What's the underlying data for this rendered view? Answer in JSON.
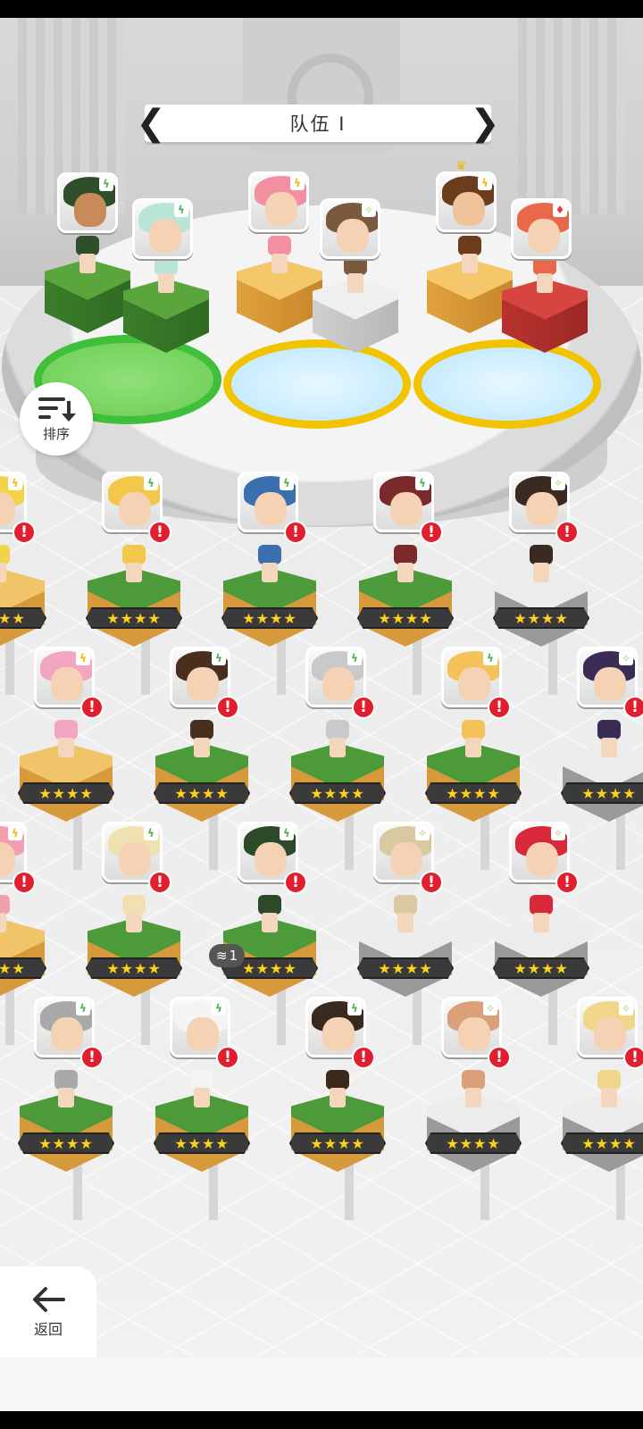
{
  "team": {
    "title": "队伍 I",
    "prev": "❮",
    "next": "❯"
  },
  "sort": {
    "label": "排序"
  },
  "back": {
    "label": "返回"
  },
  "copy_badge": {
    "count": "1"
  },
  "colors": {
    "alert": "#e0202f",
    "star": "#ffd21a",
    "green_pad": "#3fbf3a",
    "yellow_pad": "#f2c400"
  },
  "team_members": [
    {
      "element": "ϟ",
      "element_color": "#4caf50",
      "hair": "#2f4f2a",
      "skin": "#c98a5a",
      "block": "green"
    },
    {
      "element": "ϟ",
      "element_color": "#4caf50",
      "hair": "#b9e4d8",
      "skin": "#f6d2b5",
      "block": "green"
    },
    {
      "element": "ϟ",
      "element_color": "#f2b700",
      "hair": "#f28fa0",
      "skin": "#f6d2b5",
      "block": "gold"
    },
    {
      "element": "✧",
      "element_color": "#9ccc65",
      "hair": "#7a5a3c",
      "skin": "#f6d2b5",
      "block": "white"
    },
    {
      "element": "ϟ",
      "element_color": "#f2b700",
      "hair": "#6b3d1c",
      "skin": "#f0c39a",
      "block": "gold",
      "leader": true
    },
    {
      "element": "♦",
      "element_color": "#e53935",
      "hair": "#e8694a",
      "skin": "#f6d2b5",
      "block": "red"
    }
  ],
  "rows": [
    [
      {
        "element": "ϟ",
        "element_color": "#f2b700",
        "hair": "#f3d34a",
        "ped": "gold",
        "stars": "★★★★"
      },
      {
        "element": "ϟ",
        "element_color": "#4caf50",
        "hair": "#f2c84a",
        "ped": "green",
        "stars": "★★★★"
      },
      {
        "element": "ϟ",
        "element_color": "#4caf50",
        "hair": "#3a6fb0",
        "ped": "green",
        "stars": "★★★★"
      },
      {
        "element": "ϟ",
        "element_color": "#4caf50",
        "hair": "#7a2a2a",
        "ped": "green",
        "stars": "★★★★"
      },
      {
        "element": "✧",
        "element_color": "#9ccc65",
        "hair": "#3a2a22",
        "ped": "white",
        "stars": "★★★★"
      }
    ],
    [
      {
        "element": "ϟ",
        "element_color": "#f2b700",
        "hair": "#f2a6c0",
        "ped": "gold",
        "stars": "★★★★"
      },
      {
        "element": "ϟ",
        "element_color": "#4caf50",
        "hair": "#4a2e1e",
        "ped": "green",
        "stars": "★★★★"
      },
      {
        "element": "ϟ",
        "element_color": "#4caf50",
        "hair": "#c9c9c9",
        "ped": "green",
        "stars": "★★★★"
      },
      {
        "element": "ϟ",
        "element_color": "#4caf50",
        "hair": "#f3c35a",
        "ped": "green",
        "stars": "★★★★"
      },
      {
        "element": "✧",
        "element_color": "#9ccc65",
        "hair": "#3a2c55",
        "ped": "white",
        "stars": "★★★★"
      }
    ],
    [
      {
        "element": "ϟ",
        "element_color": "#f2b700",
        "hair": "#f2a0b0",
        "ped": "gold",
        "stars": "★★★★"
      },
      {
        "element": "ϟ",
        "element_color": "#4caf50",
        "hair": "#f0e2b0",
        "ped": "green",
        "stars": "★★★★"
      },
      {
        "element": "ϟ",
        "element_color": "#4caf50",
        "hair": "#2c4a2a",
        "ped": "green",
        "stars": "★★★★"
      },
      {
        "element": "✧",
        "element_color": "#9ccc65",
        "hair": "#d8c9a0",
        "ped": "white",
        "stars": "★★★★"
      },
      {
        "element": "✧",
        "element_color": "#9ccc65",
        "hair": "#d8283a",
        "ped": "white",
        "stars": "★★★★"
      }
    ],
    [
      {
        "element": "ϟ",
        "element_color": "#4caf50",
        "hair": "#a9a9a9",
        "ped": "green",
        "stars": "★★★★"
      },
      {
        "element": "ϟ",
        "element_color": "#4caf50",
        "hair": "#f4f4f4",
        "ped": "green",
        "stars": "★★★★"
      },
      {
        "element": "ϟ",
        "element_color": "#4caf50",
        "hair": "#3a2a1e",
        "ped": "green",
        "stars": "★★★★"
      },
      {
        "element": "✧",
        "element_color": "#9ccc65",
        "hair": "#d9a07a",
        "ped": "white",
        "stars": "★★★★"
      },
      {
        "element": "✧",
        "element_color": "#9ccc65",
        "hair": "#f1d68a",
        "ped": "white",
        "stars": "★★★★"
      }
    ]
  ]
}
